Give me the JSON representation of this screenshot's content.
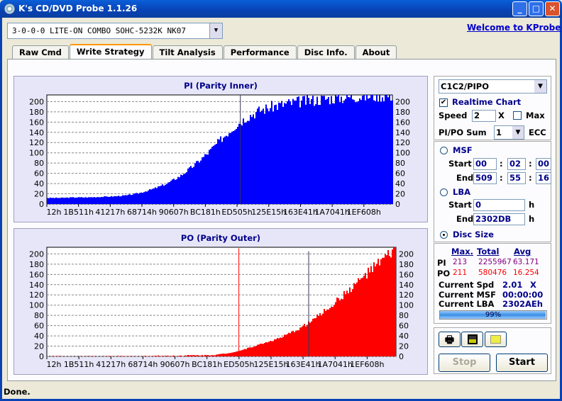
{
  "window": {
    "title": "K's CD/DVD Probe 1.1.26",
    "minimize": "_",
    "maximize": "□",
    "close": "✕"
  },
  "drive": {
    "selected": "3-0-0-0 LITE-ON COMBO SOHC-5232K NK07"
  },
  "welcome_link": "Welcome to KProbe",
  "tabs": [
    {
      "label": "Raw Cmd"
    },
    {
      "label": "Write Strategy"
    },
    {
      "label": "Tilt Analysis"
    },
    {
      "label": "Performance"
    },
    {
      "label": "Disc Info."
    },
    {
      "label": "About"
    }
  ],
  "active_tab": "Write Strategy",
  "controls": {
    "mode": "C1C2/PIPO",
    "realtime_label": "Realtime Chart",
    "realtime_checked": true,
    "speed_label": "Speed",
    "speed_value": "2",
    "speed_unit": "X",
    "max_label": "Max",
    "max_checked": false,
    "sum_label": "PI/PO Sum",
    "sum_value": "1",
    "ecc_label": "ECC",
    "msf_label": "MSF",
    "start_label": "Start",
    "end_label": "End",
    "msf_start": [
      "00",
      "02",
      "00"
    ],
    "msf_end": [
      "509",
      "55",
      "16"
    ],
    "colon": ":",
    "lba_label": "LBA",
    "lba_start": "0",
    "lba_end": "2302DB",
    "h": "h",
    "disc_size_label": "Disc Size",
    "selected_range": "Disc Size"
  },
  "stats": {
    "headers": {
      "max": "Max.",
      "total": "Total",
      "avg": "Avg"
    },
    "pi": {
      "label": "PI",
      "max": "213",
      "total": "2255967",
      "avg": "63.171"
    },
    "po": {
      "label": "PO",
      "max": "211",
      "total": "580476",
      "avg": "16.254"
    },
    "current_spd_label": "Current Spd",
    "current_spd": "2.01",
    "current_spd_unit": "X",
    "current_msf_label": "Current MSF",
    "current_msf": "00:00:00",
    "current_lba_label": "Current LBA",
    "current_lba": "2302AEh",
    "progress_text": "99%",
    "progress": 0.99
  },
  "buttons": {
    "print": "print",
    "save": "save",
    "open": "open",
    "stop": "Stop",
    "start": "Start"
  },
  "status": "Done.",
  "chart_data": [
    {
      "type": "bar",
      "title": "PI (Parity Inner)",
      "color": "#0000ff",
      "ylim": [
        0,
        213
      ],
      "yticks": [
        0,
        20,
        40,
        60,
        80,
        100,
        120,
        140,
        160,
        180,
        200
      ],
      "xticks": [
        "12h",
        "1B511h",
        "41217h",
        "68714h",
        "90607h",
        "BC181h",
        "ED505h",
        "125E15h",
        "163E41h",
        "1A7041h",
        "1EF608h"
      ],
      "xlim_lba": [
        "12h",
        "2302DBh"
      ],
      "values": [
        12,
        12,
        13,
        13,
        14,
        15,
        17,
        22,
        30,
        40,
        55,
        75,
        98,
        125,
        150,
        170,
        183,
        191,
        196,
        200,
        203,
        206,
        208,
        210,
        211,
        212,
        212
      ],
      "spikes": [
        {
          "at": 0.56,
          "value": 213
        }
      ]
    },
    {
      "type": "bar",
      "title": "PO (Parity Outer)",
      "color": "#ff0000",
      "ylim": [
        0,
        211
      ],
      "yticks": [
        0,
        20,
        40,
        60,
        80,
        100,
        120,
        140,
        160,
        180,
        200
      ],
      "xticks": [
        "12h",
        "1B511h",
        "41217h",
        "68714h",
        "90607h",
        "BC181h",
        "ED505h",
        "125E15h",
        "163E41h",
        "1A7041h",
        "1EF608h"
      ],
      "xlim_lba": [
        "12h",
        "2302DBh"
      ],
      "values": [
        0,
        0,
        0,
        0,
        0,
        0,
        0,
        0,
        1,
        1,
        1,
        2,
        2,
        3,
        6,
        12,
        20,
        28,
        36,
        48,
        62,
        80,
        100,
        122,
        145,
        168,
        190,
        210
      ],
      "spikes": [
        {
          "at": 0.55,
          "value": 211
        },
        {
          "at": 0.75,
          "value": 205
        }
      ]
    }
  ]
}
